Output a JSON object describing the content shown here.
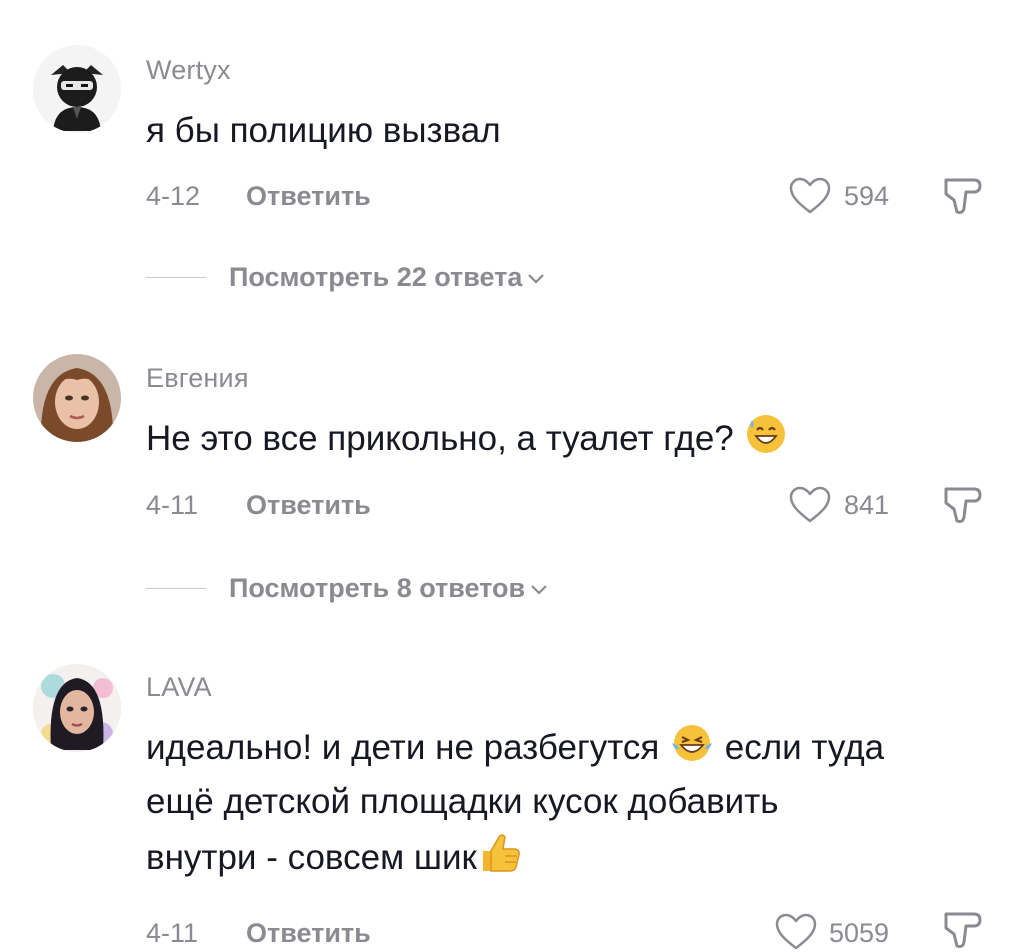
{
  "comments": [
    {
      "username": "Wertyx",
      "text": "я бы полицию вызвал",
      "date": "4-12",
      "reply_label": "Ответить",
      "likes": "594",
      "view_replies": "Посмотреть 22 ответа"
    },
    {
      "username": "Евгения",
      "text": "Не это все прикольно, а туалет где?",
      "date": "4-11",
      "reply_label": "Ответить",
      "likes": "841",
      "view_replies": "Посмотреть 8 ответов"
    },
    {
      "username": "LAVA",
      "text_part1": "идеально! и дети не разбегутся",
      "text_part2": "если туда",
      "text_line2": "ещё детской площадки кусок добавить",
      "text_line3": "внутри - совсем шик",
      "date": "4-11",
      "reply_label": "Ответить",
      "likes": "5059"
    }
  ],
  "icons": {
    "like": "heart-outline-icon",
    "dislike": "thumbs-down-outline-icon",
    "expand": "chevron-down-icon"
  },
  "colors": {
    "muted": "#8a8b91",
    "text": "#161823"
  }
}
